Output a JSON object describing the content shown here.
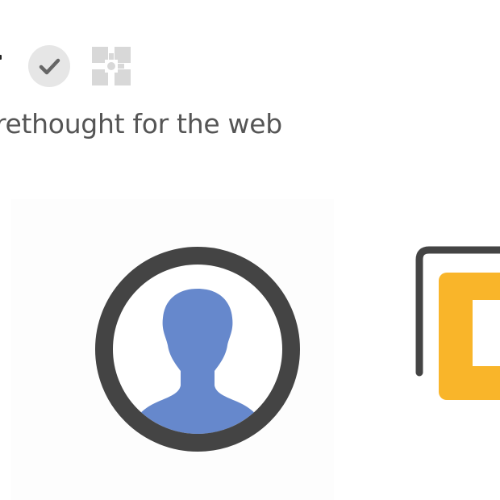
{
  "header": {
    "verified_badge_icon": "checkmark-icon",
    "extension_icon": "puzzle-icon",
    "tagline": "rethought for the web"
  },
  "features": [
    {
      "icon": "user-avatar-icon",
      "accent": "#6688cc"
    },
    {
      "icon": "gallery-stack-icon",
      "accent": "#f9b52a"
    }
  ],
  "colors": {
    "ring": "#444444",
    "tagline_text": "#555555",
    "badge_bg": "#e6e6e6",
    "badge_check": "#666666",
    "puzzle": "#d6d6d6"
  }
}
